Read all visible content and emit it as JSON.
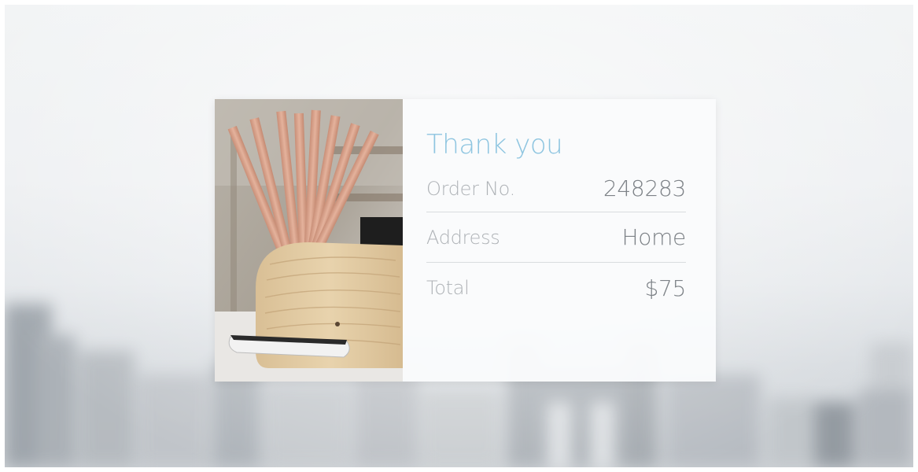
{
  "card": {
    "title": "Thank you",
    "rows": [
      {
        "label": "Order No.",
        "value": "248283"
      },
      {
        "label": "Address",
        "value": "Home"
      },
      {
        "label": "Total",
        "value": "$75"
      }
    ]
  },
  "colors": {
    "title": "#8ec5e0",
    "label": "#aeb2b6",
    "value": "#7d8287",
    "divider": "#d9dcdf"
  }
}
